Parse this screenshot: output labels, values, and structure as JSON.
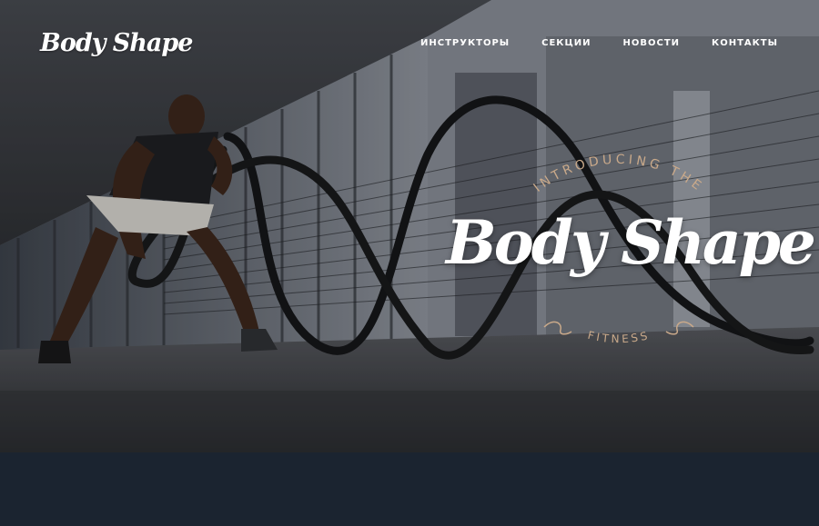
{
  "header": {
    "logo_text": "Body Shape"
  },
  "nav": {
    "items": [
      {
        "label": "ИНСТРУКТОРЫ"
      },
      {
        "label": "СЕКЦИИ"
      },
      {
        "label": "НОВОСТИ"
      },
      {
        "label": "КОНТАКТЫ"
      }
    ]
  },
  "hero": {
    "tagline_top": "INTRODUCING THE",
    "brand_name": "Body Shape",
    "tagline_bottom": "FITNESS",
    "accent_color": "#c9a98a"
  }
}
